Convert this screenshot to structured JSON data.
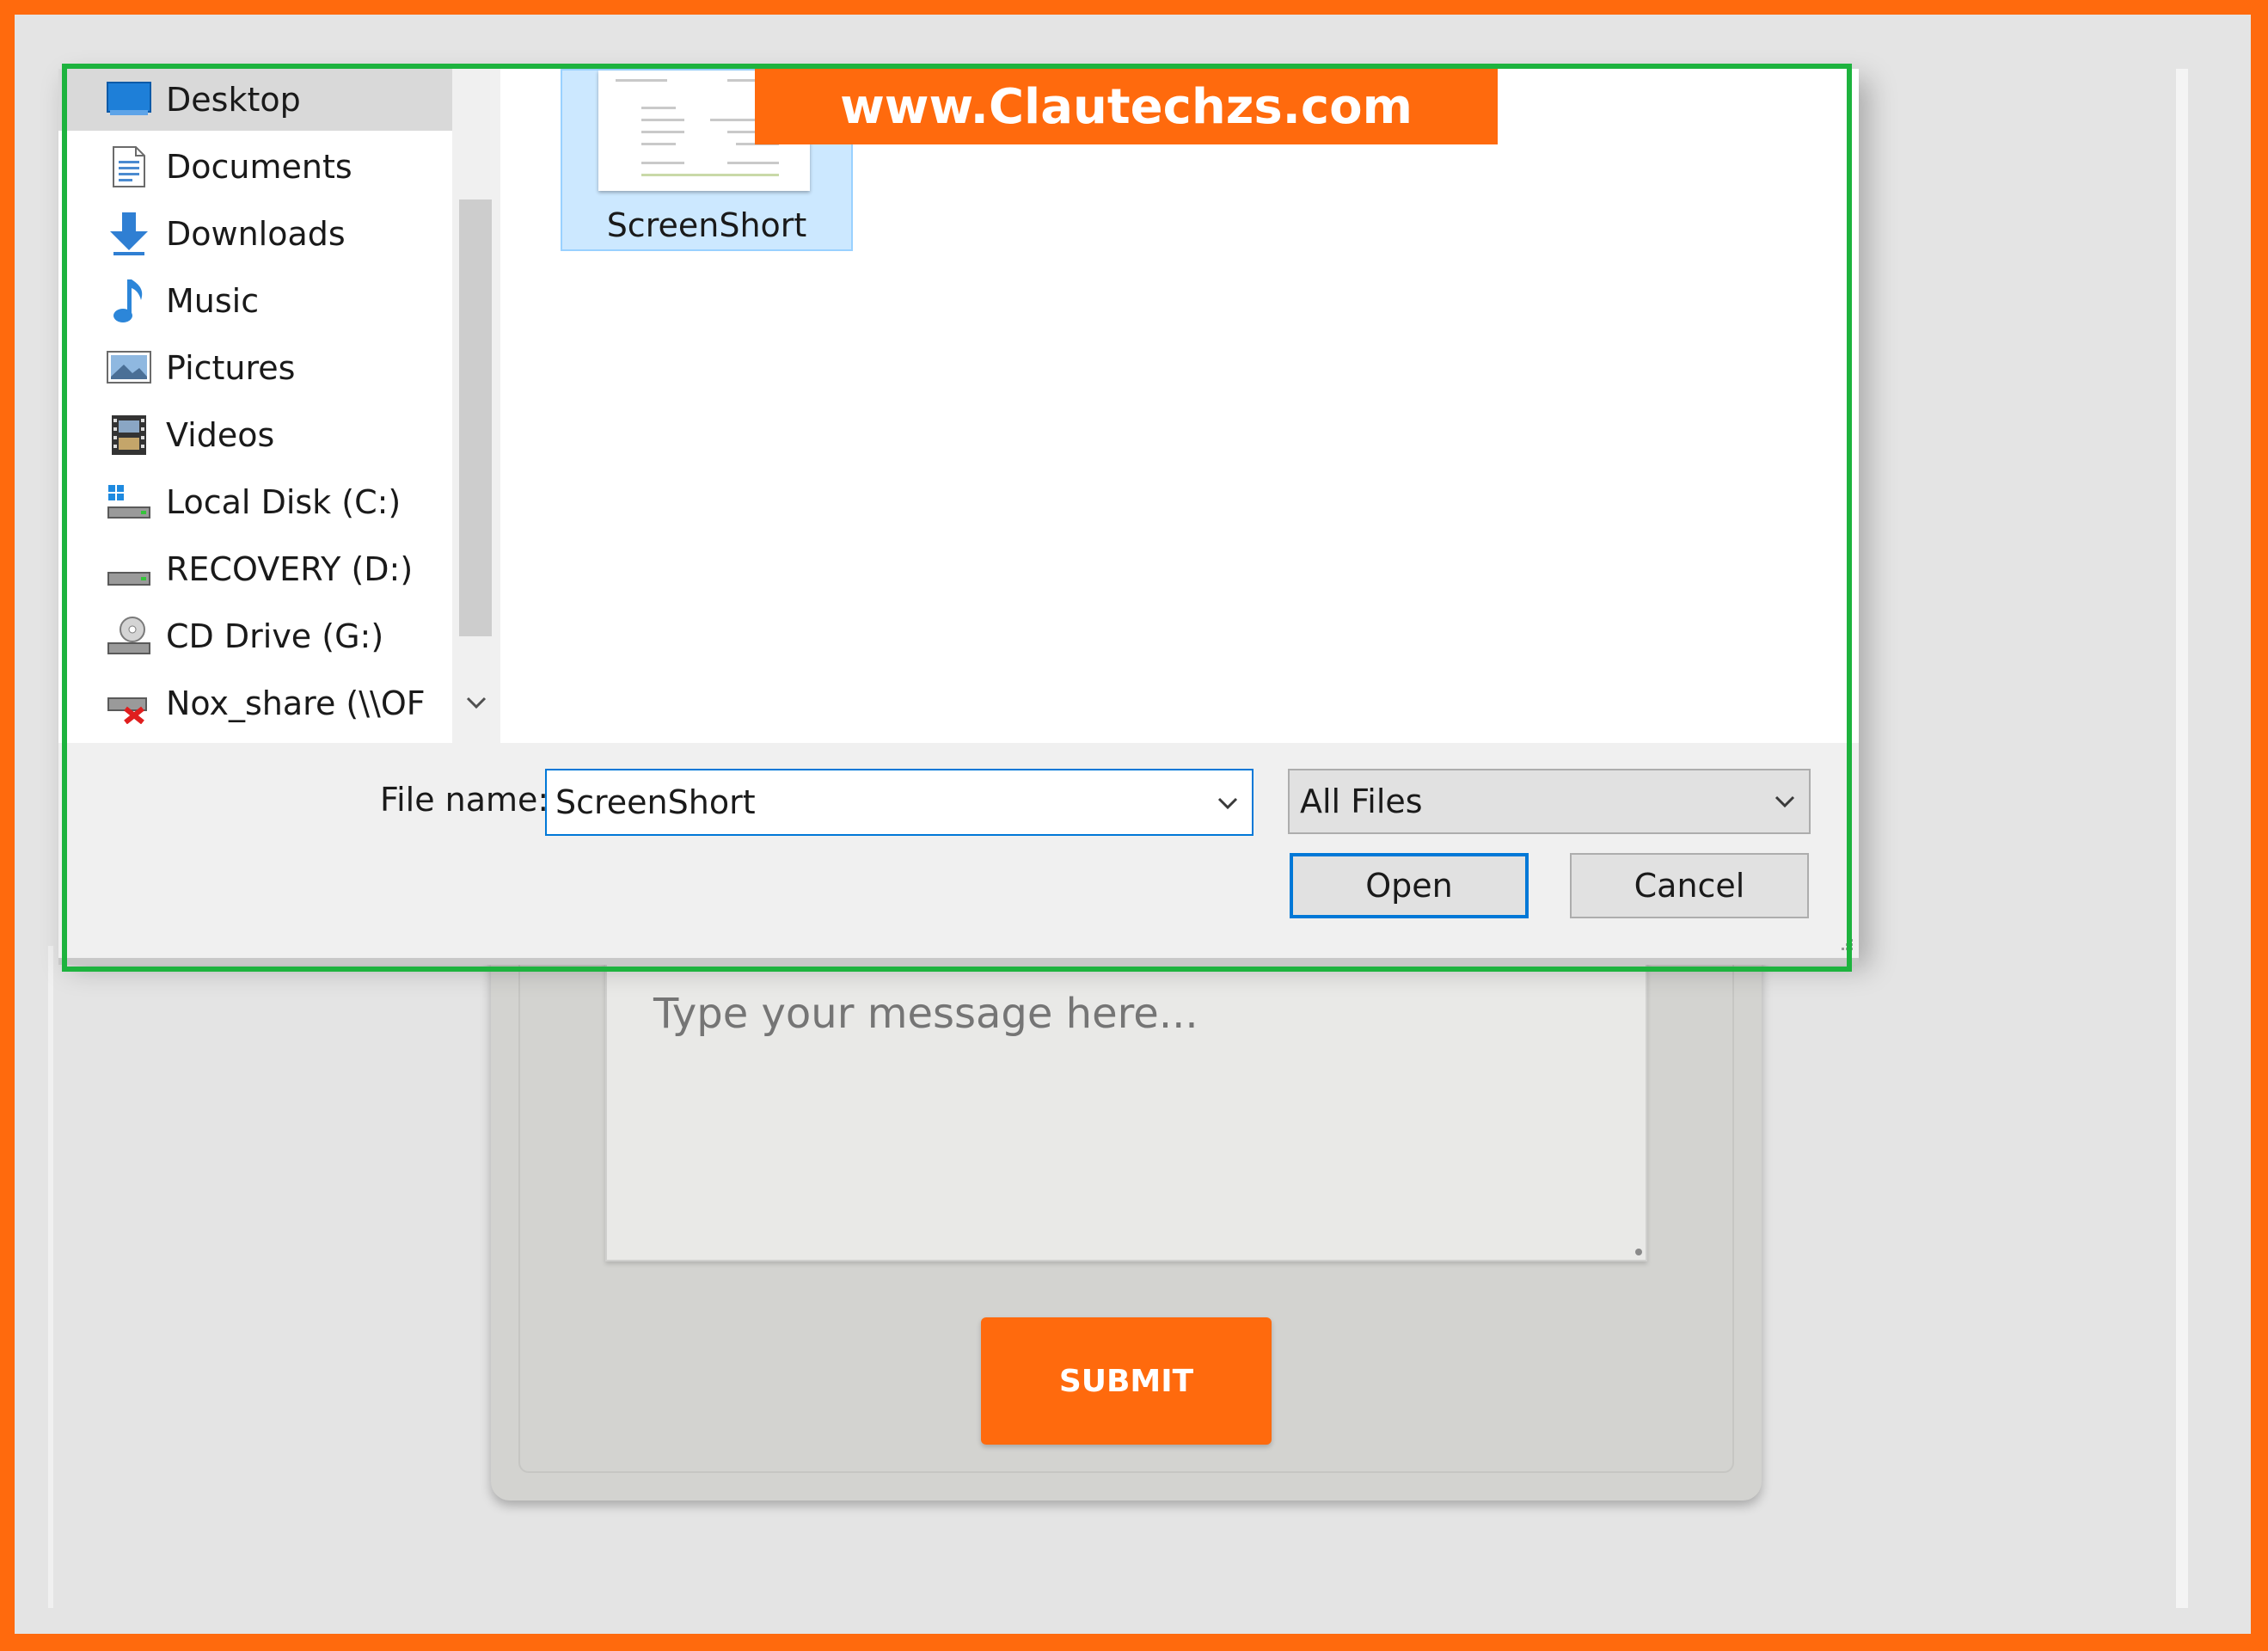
{
  "watermark": {
    "text": "www.Clautechzs.com"
  },
  "dialog": {
    "nav_items": [
      {
        "label": "Desktop",
        "icon": "desktop-icon"
      },
      {
        "label": "Documents",
        "icon": "documents-icon"
      },
      {
        "label": "Downloads",
        "icon": "downloads-icon"
      },
      {
        "label": "Music",
        "icon": "music-icon"
      },
      {
        "label": "Pictures",
        "icon": "pictures-icon"
      },
      {
        "label": "Videos",
        "icon": "videos-icon"
      },
      {
        "label": "Local Disk (C:)",
        "icon": "local-disk-icon"
      },
      {
        "label": "RECOVERY (D:)",
        "icon": "drive-icon"
      },
      {
        "label": "CD Drive (G:)",
        "icon": "cd-drive-icon"
      },
      {
        "label": "Nox_share (\\\\OF",
        "icon": "network-drive-disconnected-icon"
      }
    ],
    "files": [
      {
        "name": "ScreenShort"
      }
    ],
    "file_name_label": "File name:",
    "file_name_value": "ScreenShort",
    "file_type_value": "All Files",
    "open_label": "Open",
    "cancel_label": "Cancel"
  },
  "form": {
    "message_placeholder": "Type your message here...",
    "submit_label": "SUBMIT"
  },
  "colors": {
    "brand_orange": "#ff6a0d",
    "highlight_green": "#1db33e",
    "accent_blue": "#0078d7"
  }
}
